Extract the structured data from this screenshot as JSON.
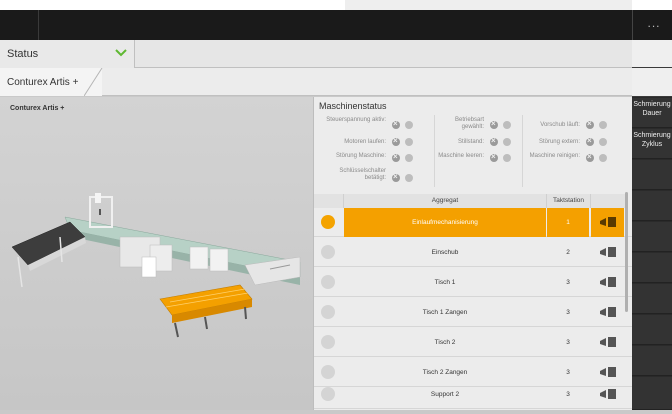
{
  "app": {
    "status_label": "Status",
    "tab_label": "Conturex Artis +",
    "menu_dots": "..."
  },
  "right_panel": {
    "btn1": "Schmierung Dauer",
    "btn2": "Schmierung Zyklus"
  },
  "viewer": {
    "title": "Conturex Artis +"
  },
  "machine_status": {
    "title": "Maschinenstatus",
    "signals": [
      {
        "label": "Steuerspannung aktiv:"
      },
      {
        "label": "Motoren laufen:"
      },
      {
        "label": "Störung Maschine:"
      },
      {
        "label": "Schlüsselschalter betätigt:"
      },
      {
        "label": "Betriebsart gewählt:"
      },
      {
        "label": "Stillstand:"
      },
      {
        "label": "Maschine leeren:"
      },
      {
        "label": "Vorschub läuft:"
      },
      {
        "label": "Störung extern:"
      },
      {
        "label": "Maschine reinigen:"
      }
    ]
  },
  "table": {
    "headers": {
      "aggregat": "Aggregat",
      "takt": "Taktstation"
    },
    "rows": [
      {
        "name": "Einlaufmechanisierung",
        "takt": "1"
      },
      {
        "name": "Einschub",
        "takt": "2"
      },
      {
        "name": "Tisch 1",
        "takt": "3"
      },
      {
        "name": "Tisch 1 Zangen",
        "takt": "3"
      },
      {
        "name": "Tisch 2",
        "takt": "3"
      },
      {
        "name": "Tisch 2 Zangen",
        "takt": "3"
      },
      {
        "name": "Support 2",
        "takt": "3"
      }
    ]
  },
  "colors": {
    "accent": "#f4a000",
    "chevron": "#5fb832",
    "topbar": "#1a1a1a"
  },
  "icons": [
    "chevron-down-icon",
    "more-icon",
    "tool-icon",
    "status-led-icon"
  ]
}
